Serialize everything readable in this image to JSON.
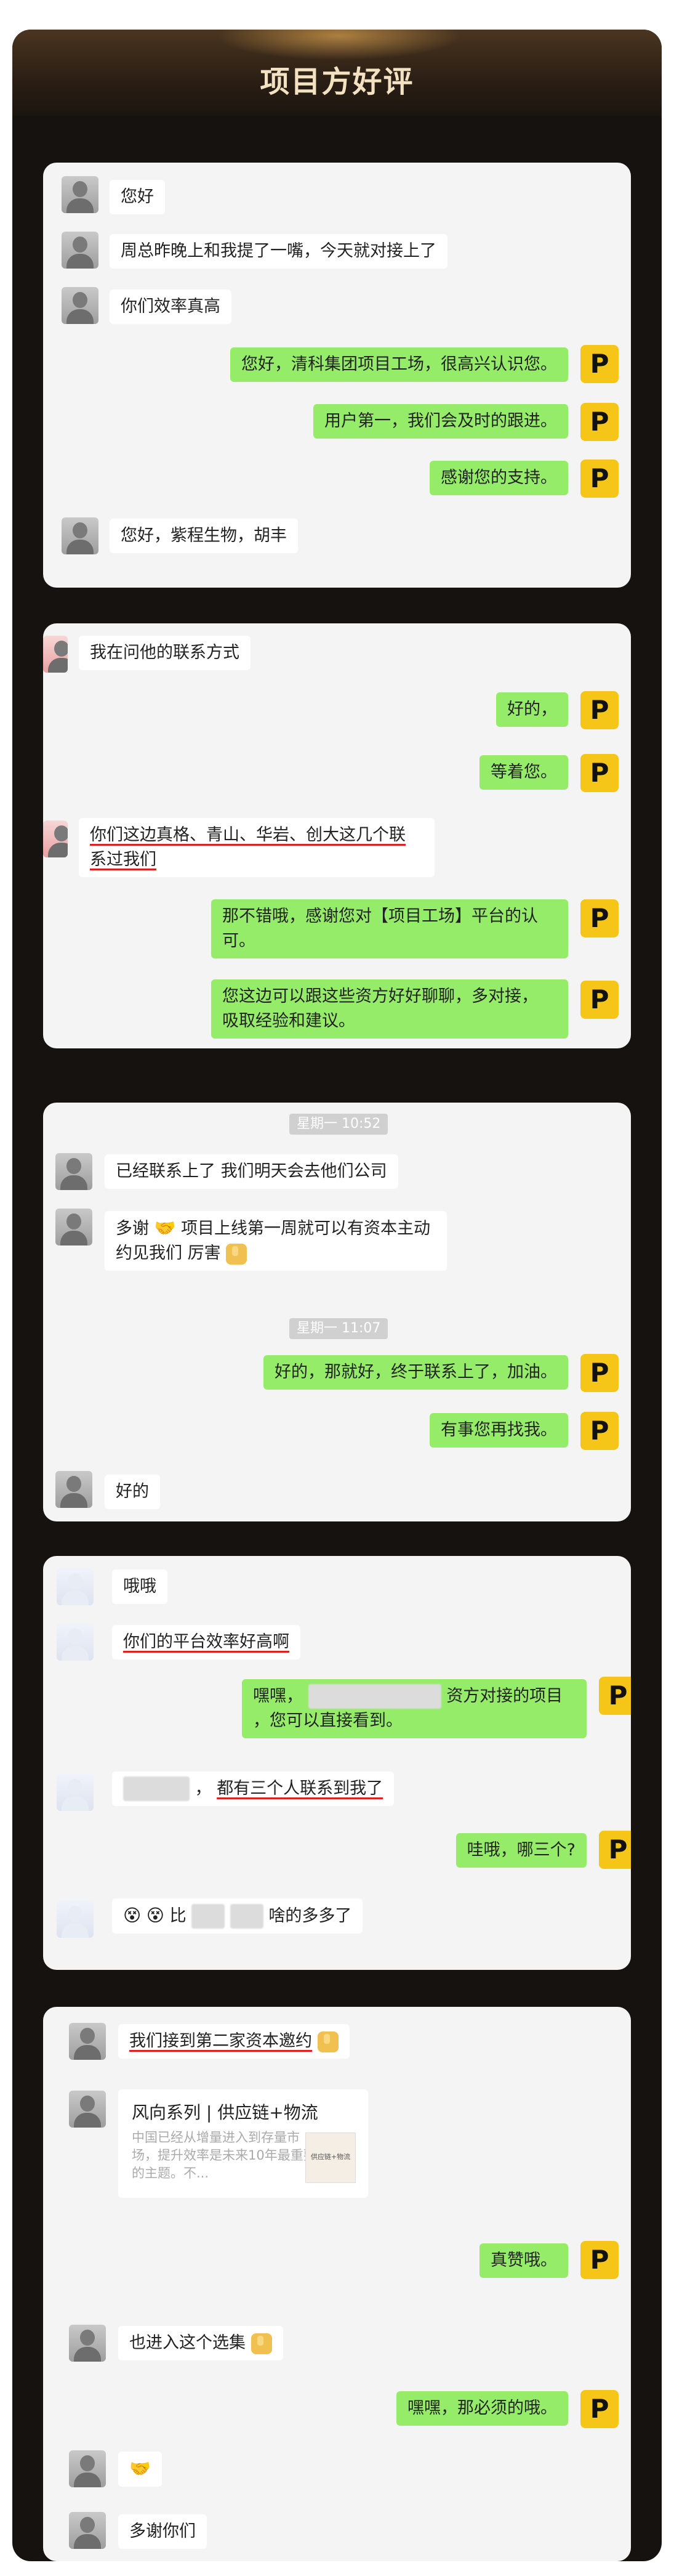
{
  "header": {
    "title": "项目方好评"
  },
  "cards": [
    {
      "messages": [
        {
          "side": "left",
          "text": "您好"
        },
        {
          "side": "left",
          "text": "周总昨晚上和我提了一嘴，今天就对接上了"
        },
        {
          "side": "left",
          "text": "你们效率真高"
        },
        {
          "side": "right",
          "text": "您好，清科集团项目工场，很高兴认识您。"
        },
        {
          "side": "right",
          "text": "用户第一，我们会及时的跟进。"
        },
        {
          "side": "right",
          "text": "感谢您的支持。"
        },
        {
          "side": "left",
          "text": "您好，紫程生物，胡丰"
        }
      ]
    },
    {
      "messages": [
        {
          "side": "left",
          "text": "我在问他的联系方式"
        },
        {
          "side": "right",
          "text": "好的，"
        },
        {
          "side": "right",
          "text": "等着您。"
        },
        {
          "side": "left",
          "line1": "你们这边真格、青山、华岩、创大这几个联",
          "line2": "系过我们"
        },
        {
          "side": "right",
          "line1": "那不错哦，感谢您对【项目工场】平台的认",
          "line2": "可。"
        },
        {
          "side": "right",
          "line1": "您这边可以跟这些资方好好聊聊，多对接，",
          "line2": "吸取经验和建议。"
        }
      ]
    },
    {
      "timestamps": [
        "星期一 10:52",
        "星期一 11:07"
      ],
      "messages": [
        {
          "side": "left",
          "text": "已经联系上了 我们明天会去他们公司"
        },
        {
          "side": "left",
          "line1": "多谢",
          "line1b": "项目上线第一周就可以有资本主动",
          "line2": "约见我们 厉害"
        },
        {
          "side": "right",
          "text": "好的，那就好，终于联系上了，加油。"
        },
        {
          "side": "right",
          "text": "有事您再找我。"
        },
        {
          "side": "left",
          "text": "好的"
        }
      ]
    },
    {
      "messages": [
        {
          "side": "left",
          "text": "哦哦"
        },
        {
          "side": "left",
          "text": "你们的平台效率好高啊"
        },
        {
          "side": "right",
          "line1_a": "嘿嘿，",
          "line1_b": "资方对接的项目",
          "line2": "，您可以直接看到。"
        },
        {
          "side": "left",
          "text_a": "，",
          "text_b": "都有三个人联系到我了"
        },
        {
          "side": "right",
          "text": "哇哦，哪三个?"
        },
        {
          "side": "left",
          "text_a": "比",
          "text_b": "啥的多多了"
        }
      ]
    },
    {
      "messages": [
        {
          "side": "left",
          "text": "我们接到第二家资本邀约"
        },
        {
          "side": "left",
          "link_title": "风向系列 | 供应链+物流",
          "link_desc": "中国已经从增量进入到存量市场，提升效率是未来10年最重要的主题。不...",
          "link_thumb": "供应链+物流"
        },
        {
          "side": "right",
          "text": "真赞哦。"
        },
        {
          "side": "left",
          "text": "也进入这个选集"
        },
        {
          "side": "right",
          "text": "嘿嘿，那必须的哦。"
        },
        {
          "side": "left",
          "text": "多谢你们"
        }
      ]
    }
  ],
  "icons": {
    "badge_letter": "P"
  },
  "colors": {
    "accent": "#f5c518",
    "bubble_green": "#95ec69",
    "frame": "#16120f"
  }
}
